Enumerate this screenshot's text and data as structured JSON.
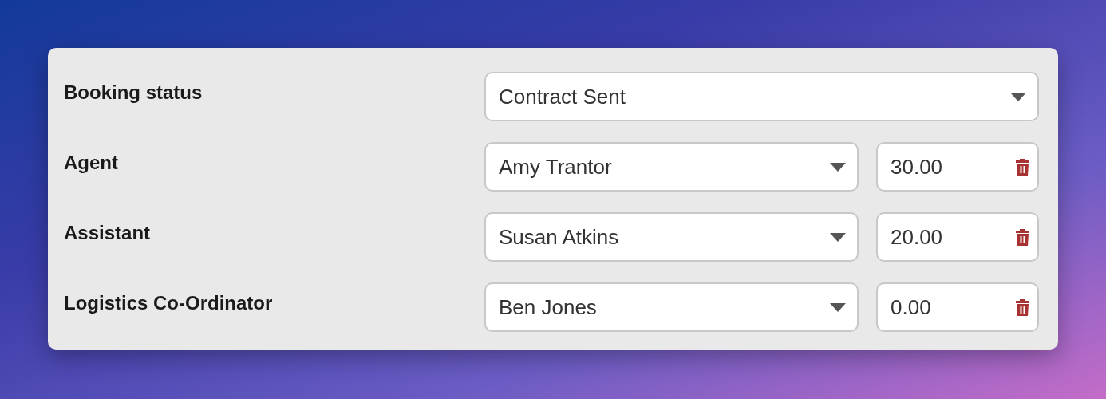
{
  "rows": [
    {
      "kind": "single",
      "label": "Booking status",
      "value": "Contract Sent"
    },
    {
      "kind": "assignment",
      "label": "Agent",
      "value": "Amy Trantor",
      "amount": "30.00"
    },
    {
      "kind": "assignment",
      "label": "Assistant",
      "value": "Susan Atkins",
      "amount": "20.00"
    },
    {
      "kind": "assignment",
      "label": "Logistics Co-Ordinator",
      "value": "Ben Jones",
      "amount": "0.00"
    }
  ]
}
